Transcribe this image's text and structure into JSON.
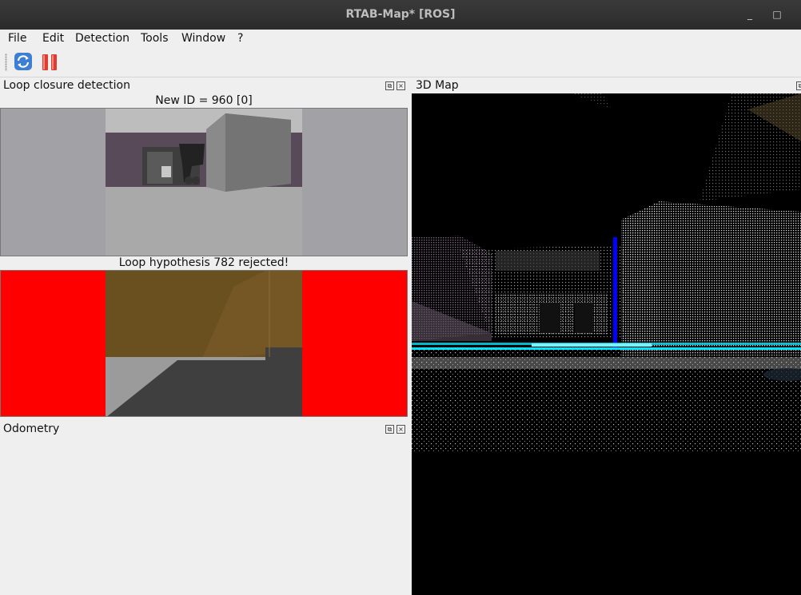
{
  "window": {
    "title": "RTAB-Map* [ROS]",
    "minimize_glyph": "_",
    "maximize_glyph": "□"
  },
  "menu": [
    "File",
    "Edit",
    "Detection",
    "Tools",
    "Window",
    "?"
  ],
  "toolbar": {
    "icons": [
      "refresh-icon",
      "pause-icon"
    ]
  },
  "docks": {
    "loop": {
      "title": "Loop closure detection",
      "new_id_caption": "New ID = 960 [0]",
      "hypothesis_caption": "Loop hypothesis 782 rejected!"
    },
    "odometry": {
      "title": "Odometry"
    },
    "map3d": {
      "title": "3D Map"
    },
    "float_glyph": "⧉",
    "close_glyph": "×"
  },
  "colors": {
    "rejected": "#ff0000",
    "titlebar": "#2f2f2f",
    "trajectory": "#00e5ff",
    "axis": "#0000ff"
  }
}
